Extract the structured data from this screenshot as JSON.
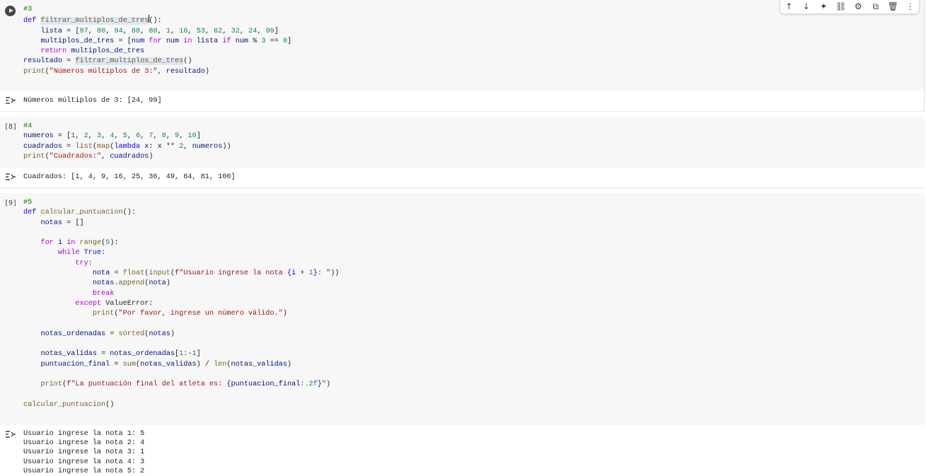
{
  "toolbar": {
    "items": [
      {
        "name": "move-up-icon",
        "glyph": "↑"
      },
      {
        "name": "move-down-icon",
        "glyph": "↓"
      },
      {
        "name": "gemini-sparkle-icon",
        "glyph": "✦"
      },
      {
        "name": "link-icon",
        "glyph": "⛓"
      },
      {
        "name": "gear-icon",
        "glyph": "⚙"
      },
      {
        "name": "mirror-cell-icon",
        "glyph": "⧉"
      },
      {
        "name": "trash-icon",
        "glyph": "🗑"
      },
      {
        "name": "more-vert-icon",
        "glyph": "⋮"
      }
    ]
  },
  "cells": [
    {
      "exec_count": "",
      "output": [
        "Números múltiplos de 3: [24, 99]"
      ]
    },
    {
      "exec_count": "[8]",
      "output": [
        "Cuadrados: [1, 4, 9, 16, 25, 36, 49, 64, 81, 100]"
      ]
    },
    {
      "exec_count": "[9]",
      "output": [
        "Usuario ingrese la nota 1: 5",
        "Usuario ingrese la nota 2: 4",
        "Usuario ingrese la nota 3: 1",
        "Usuario ingrese la nota 4: 3",
        "Usuario ingrese la nota 5: 2"
      ]
    }
  ],
  "code": {
    "c3": {
      "l1": "#3",
      "l2a": "def",
      "l2b": "filtrar_multiplos_de_tre",
      "l2c": "s",
      "l2d": "():",
      "l3a": "lista",
      "l3b": " = [",
      "l3n": [
        "97",
        "80",
        "94",
        "88",
        "80",
        "1",
        "16",
        "53",
        "62",
        "32",
        "24",
        "99"
      ],
      "l3c": "]",
      "l4a": "multiplos_de_tres",
      "l4b": " = [",
      "l4c": "num",
      "l4d": "for",
      "l4e": "num",
      "l4f": "in",
      "l4g": "lista",
      "l4h": "if",
      "l4i": "num",
      "l4j": " % ",
      "l4k": "3",
      "l4l": " == ",
      "l4m": "0",
      "l4n": "]",
      "l5a": "return",
      "l5b": "multiplos_de_tres",
      "l6a": "resultado",
      "l6b": " = ",
      "l6c": "filtrar_multiplos_de_tres",
      "l6d": "()",
      "l7a": "print",
      "l7b": "(",
      "l7c": "\"Números múltiplos de 3:\"",
      "l7d": ", ",
      "l7e": "resultado",
      "l7f": ")"
    },
    "c4": {
      "l1": "#4",
      "l2a": "numeros",
      "l2b": " = [",
      "l2n": [
        "1",
        "2",
        "3",
        "4",
        "5",
        "6",
        "7",
        "8",
        "9",
        "10"
      ],
      "l2c": "]",
      "l3a": "cuadrados",
      "l3b": " = ",
      "l3c": "list",
      "l3d": "(",
      "l3e": "map",
      "l3f": "(",
      "l3g": "lambda",
      "l3h": "x",
      "l3i": ": ",
      "l3j": "x",
      "l3k": " ** ",
      "l3l": "2",
      "l3m": ", ",
      "l3o": "numeros",
      "l3p": "))",
      "l4a": "print",
      "l4b": "(",
      "l4c": "\"Cuadrados:\"",
      "l4d": ", ",
      "l4e": "cuadrados",
      "l4f": ")"
    },
    "c5": {
      "l1": "#5",
      "l2a": "def",
      "l2b": "calcular_puntuacion",
      "l2c": "():",
      "l3a": "notas",
      "l3b": " = []",
      "l5a": "for",
      "l5b": "i",
      "l5c": "in",
      "l5d": "range",
      "l5e": "(",
      "l5f": "5",
      "l5g": "):",
      "l6a": "while",
      "l6b": "True",
      "l6c": ":",
      "l7a": "try",
      "l7b": ":",
      "l8a": "nota",
      "l8b": " = ",
      "l8c": "float",
      "l8d": "(",
      "l8e": "input",
      "l8f": "(",
      "l8g": "f\"Usuario ingrese la nota ",
      "l8h": "{",
      "l8i": "i",
      "l8j": " + ",
      "l8k": "1",
      "l8l": "}",
      "l8m": ": \"",
      "l8n": "))",
      "l9a": "notas",
      "l9b": ".",
      "l9c": "append",
      "l9d": "(",
      "l9e": "nota",
      "l9f": ")",
      "l10": "break",
      "l11a": "except",
      "l11b": "ValueError",
      "l11c": ":",
      "l12a": "print",
      "l12b": "(",
      "l12c": "\"Por favor, ingrese un número válido.\"",
      "l12d": ")",
      "l14a": "notas_ordenadas",
      "l14b": " = ",
      "l14c": "sorted",
      "l14d": "(",
      "l14e": "notas",
      "l14f": ")",
      "l16a": "notas_validas",
      "l16b": " = ",
      "l16c": "notas_ordenadas",
      "l16d": "[",
      "l16e": "1",
      "l16f": ":-",
      "l16g": "1",
      "l16h": "]",
      "l17a": "puntuacion_final",
      "l17b": " = ",
      "l17c": "sum",
      "l17d": "(",
      "l17e": "notas_validas",
      "l17f": ") / ",
      "l17g": "len",
      "l17h": "(",
      "l17i": "notas_validas",
      "l17j": ")",
      "l19a": "print",
      "l19b": "(",
      "l19c": "f\"La puntuación final del atleta es: ",
      "l19d": "{",
      "l19e": "puntuacion_final",
      "l19f": ":.2f",
      "l19g": "}",
      "l19h": "\"",
      "l19i": ")",
      "l21a": "calcular_puntuacion",
      "l21b": "()"
    }
  }
}
